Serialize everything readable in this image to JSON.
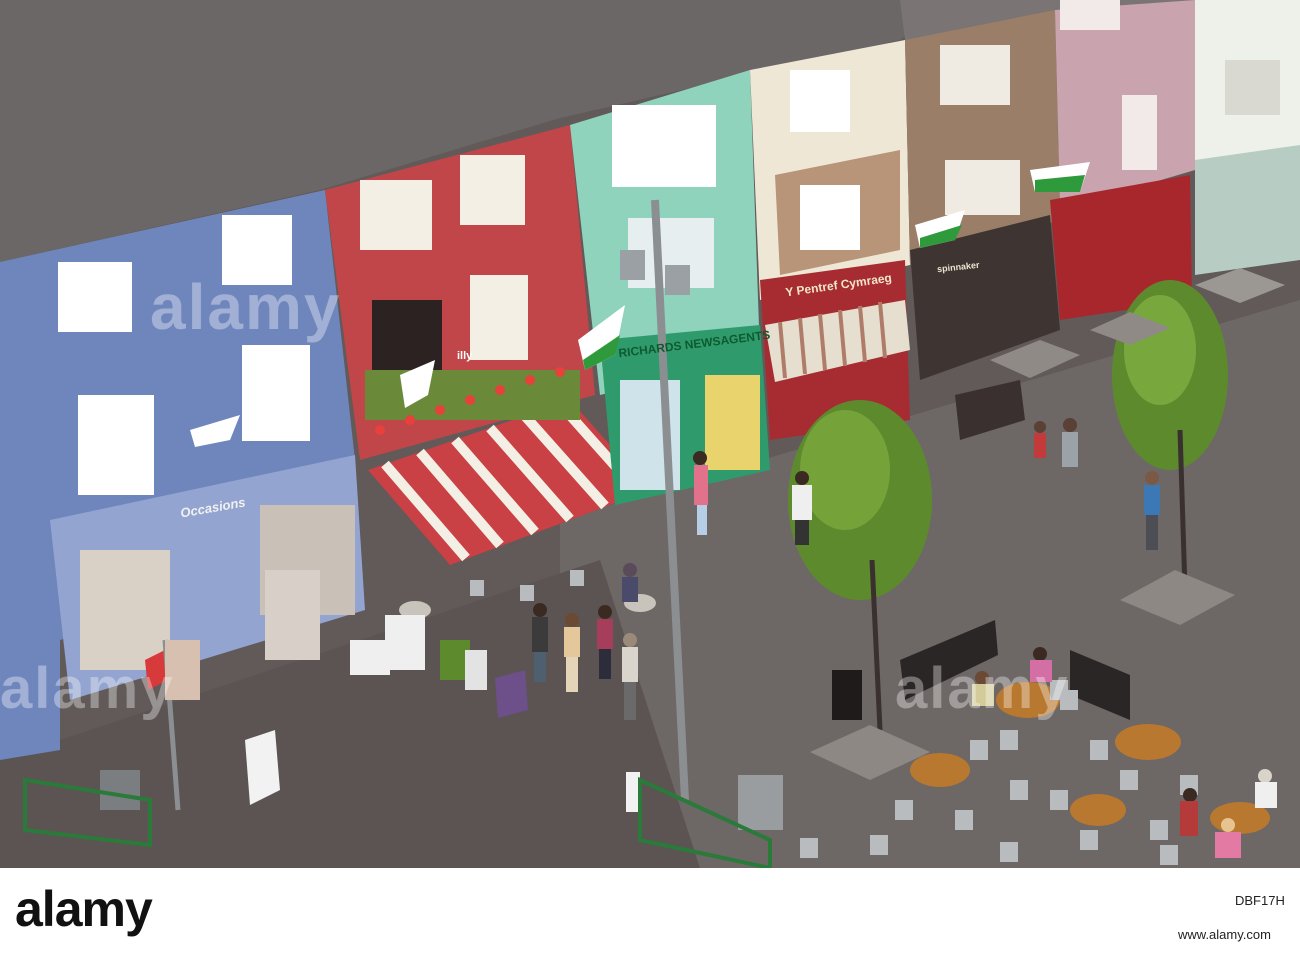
{
  "photo": {
    "alt": "",
    "signs": {
      "newsagent": "RICHARDS NEWSAGENTS",
      "bookshop": "Y Pentref Cymraeg",
      "gift_shop": "Occasions",
      "cafe_logo": "illy",
      "bar": "spinnaker"
    }
  },
  "watermark": {
    "text": "alamy",
    "repeat_left": "alamy",
    "repeat_right": "alamy"
  },
  "footer": {
    "logo": "alamy",
    "image_id": "DBF17H",
    "url": "www.alamy.com"
  },
  "colors": {
    "blue_shop": "#6f86bd",
    "red_shop": "#c0464a",
    "mint_shop": "#8fd3bd",
    "cream_shop": "#efe7d6",
    "brown_shop": "#9a7e68",
    "pink_shop": "#c9a3ae",
    "white_shop": "#eef0ea",
    "roof": "#6b6766",
    "paving": "#5f5858"
  }
}
